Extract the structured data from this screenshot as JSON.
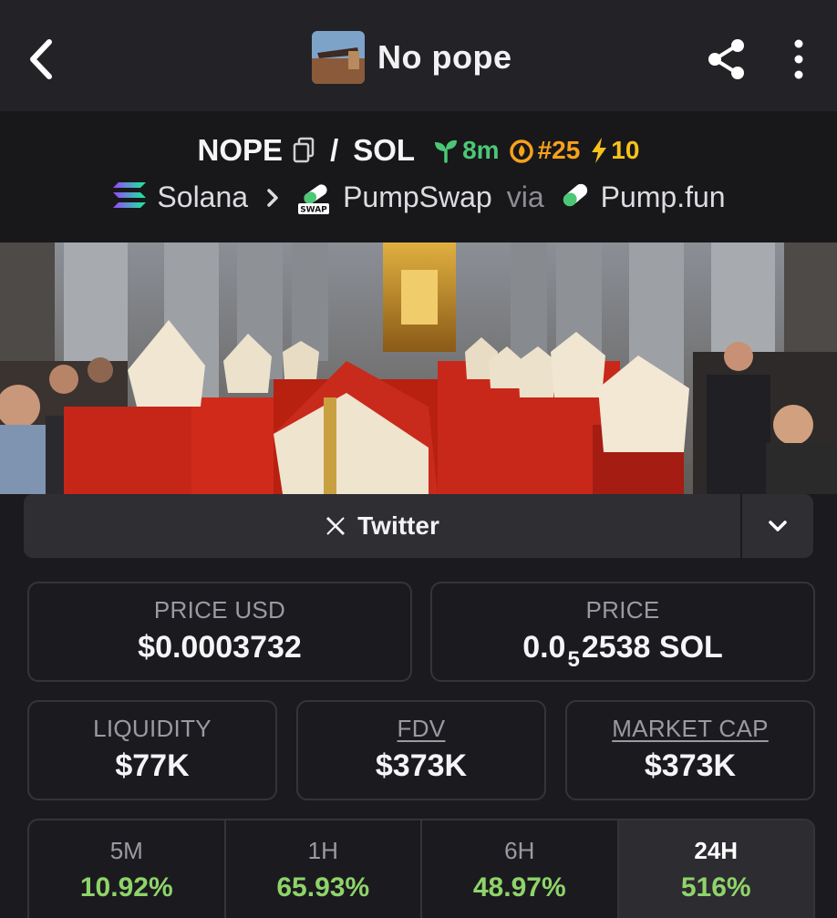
{
  "header": {
    "title": "No pope",
    "back_icon": "chevron-left-icon",
    "share_icon": "share-icon",
    "more_icon": "more-vertical-icon"
  },
  "pair": {
    "base": "NOPE",
    "slash": "/",
    "quote": "SOL",
    "age": "8m",
    "rank": "#25",
    "boosts": "10",
    "colors": {
      "age": "#4cc776",
      "rank": "#f7a21b",
      "boosts": "#f7c21b"
    }
  },
  "route": {
    "chain": "Solana",
    "dex": "PumpSwap",
    "via": "via",
    "launchpad": "Pump.fun",
    "swap_badge": "SWAP"
  },
  "socials": {
    "twitter_label": "Twitter"
  },
  "stats": {
    "price_usd_label": "PRICE USD",
    "price_usd": "$0.0003732",
    "price_label": "PRICE",
    "price_prefix": "0.0",
    "price_sub": "5",
    "price_suffix": "2538 SOL",
    "liquidity_label": "LIQUIDITY",
    "liquidity": "$77K",
    "fdv_label": "FDV",
    "fdv": "$373K",
    "mcap_label": "MARKET CAP",
    "mcap": "$373K"
  },
  "changes": [
    {
      "period": "5M",
      "value": "10.92%"
    },
    {
      "period": "1H",
      "value": "65.93%"
    },
    {
      "period": "6H",
      "value": "48.97%"
    },
    {
      "period": "24H",
      "value": "516%"
    }
  ],
  "theme": {
    "positive": "#8fd46a",
    "background": "#1b1b1f"
  }
}
